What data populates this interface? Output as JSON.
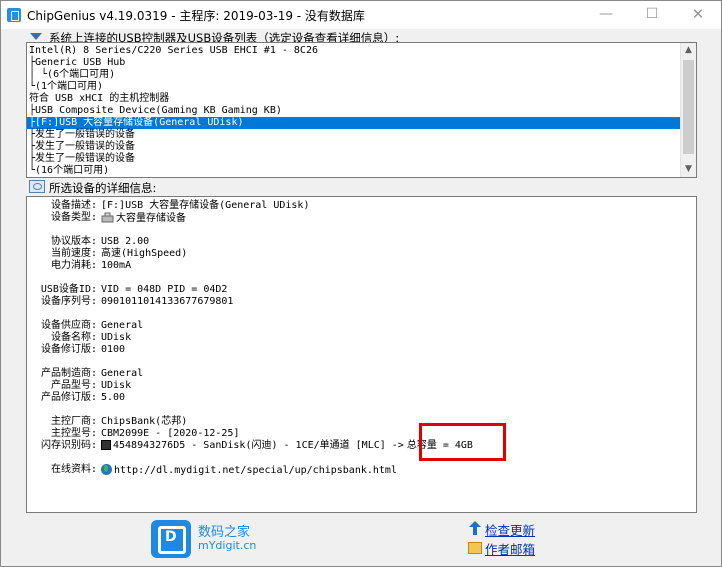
{
  "window": {
    "title": "ChipGenius v4.19.0319 - 主程序: 2019-03-19 - 没有数据库",
    "minimize": "—",
    "maximize": "☐",
    "close": "✕"
  },
  "tree": {
    "label": "系统上连接的USB控制器及USB设备列表（选定设备查看详细信息）:",
    "rows": [
      "Intel(R) 8 Series/C220 Series USB EHCI #1 - 8C26",
      "├Generic USB Hub",
      "│ └(6个端口可用)",
      "└(1个端口可用)",
      "符合 USB xHCI 的主机控制器",
      "├USB Composite Device(Gaming KB Gaming KB)",
      "├[F:]USB 大容量存储设备(General UDisk)",
      "├发生了一般错误的设备",
      "├发生了一般错误的设备",
      "├发生了一般错误的设备",
      "└(16个端口可用)"
    ],
    "selected_index": 6,
    "scroll_up": "▲",
    "scroll_down": "▼"
  },
  "details": {
    "label": "所选设备的详细信息:",
    "fields": [
      {
        "label": "设备描述:",
        "value": "[F:]USB 大容量存储设备(General UDisk)"
      },
      {
        "label": "设备类型:",
        "value": "大容量存储设备"
      },
      {
        "label": "协议版本:",
        "value": "USB 2.00"
      },
      {
        "label": "当前速度:",
        "value": "高速(HighSpeed)"
      },
      {
        "label": "电力消耗:",
        "value": "100mA"
      },
      {
        "label": "USB设备ID:",
        "value": "VID = 048D PID = 04D2"
      },
      {
        "label": "设备序列号:",
        "value": "0901011014133677679801"
      },
      {
        "label": "设备供应商:",
        "value": "General"
      },
      {
        "label": "设备名称:",
        "value": "UDisk"
      },
      {
        "label": "设备修订版:",
        "value": "0100"
      },
      {
        "label": "产品制造商:",
        "value": "General"
      },
      {
        "label": "产品型号:",
        "value": "UDisk"
      },
      {
        "label": "产品修订版:",
        "value": "5.00"
      },
      {
        "label": "主控厂商:",
        "value": "ChipsBank(芯邦)"
      },
      {
        "label": "主控型号:",
        "value": "CBM2099E - [2020-12-25]"
      },
      {
        "label": "闪存识别码:",
        "value": "4548943276D5 - SanDisk(闪迪) - 1CE/单通道 [MLC] ->",
        "extra": "总容量 = 4GB"
      },
      {
        "label": "在线资料:",
        "value": "http://dl.mydigit.net/special/up/chipsbank.html"
      }
    ]
  },
  "footer": {
    "logo_name": "数码之家",
    "logo_url": "mYdigit.cn",
    "check_update": "检查更新",
    "author_mail": "作者邮箱"
  },
  "colors": {
    "selection": "#0078d7",
    "highlight_box": "#e00000",
    "link": "#0033aa",
    "brand": "#1e88e5"
  }
}
